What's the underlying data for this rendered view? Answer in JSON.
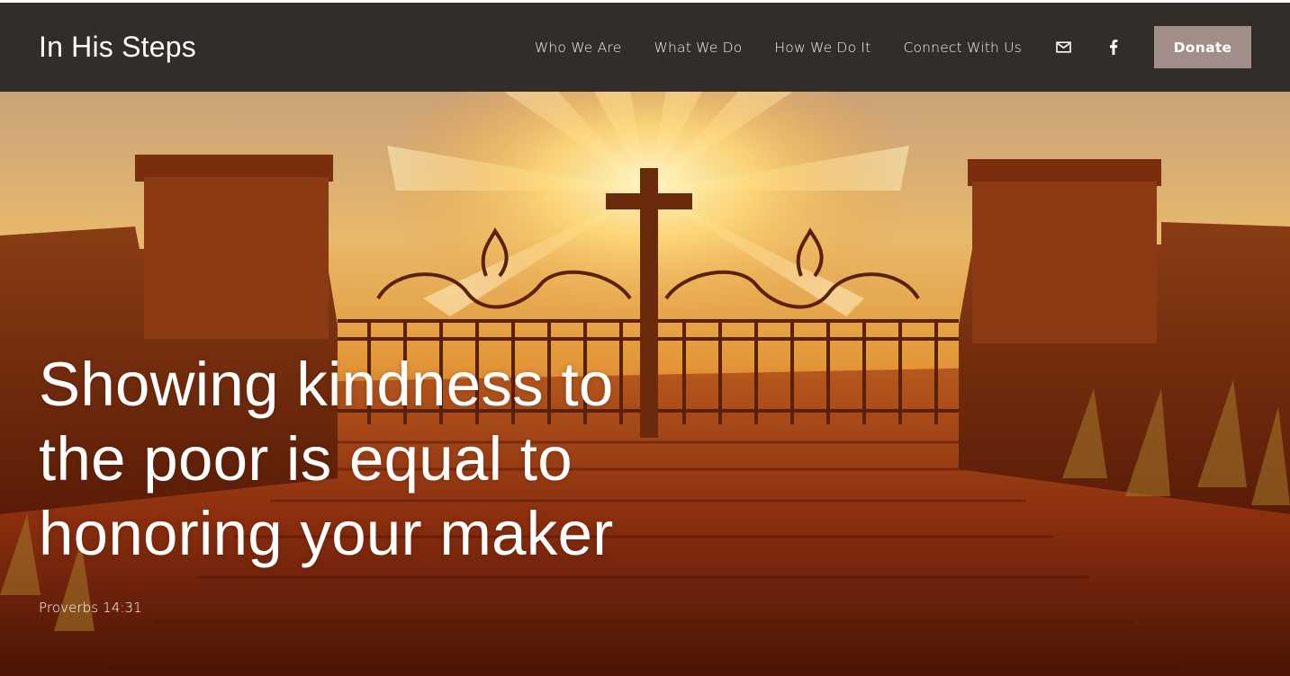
{
  "header": {
    "site_title": "In His Steps",
    "background_color": "#332d2a",
    "nav": [
      {
        "label": "Who We Are"
      },
      {
        "label": "What We Do"
      },
      {
        "label": "How We Do It"
      },
      {
        "label": "Connect With Us"
      }
    ],
    "icons": [
      "mail-icon",
      "facebook-icon"
    ],
    "donate_label": "Donate",
    "donate_color": "#a18e88"
  },
  "hero": {
    "quote": "Showing kindness to the poor is equal to honoring your maker",
    "citation": "Proverbs 14:31",
    "image_subject": "cross-gate-sunrise-photo"
  }
}
